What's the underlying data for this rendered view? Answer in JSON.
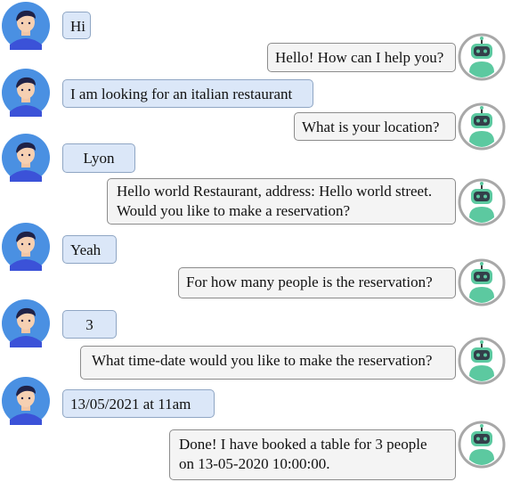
{
  "conversation": {
    "messages": [
      {
        "speaker": "user",
        "text": "Hi"
      },
      {
        "speaker": "bot",
        "text": "Hello! How can I help you?"
      },
      {
        "speaker": "user",
        "text": "I am looking for an italian restaurant"
      },
      {
        "speaker": "bot",
        "text": "What is your location?"
      },
      {
        "speaker": "user",
        "text": "Lyon"
      },
      {
        "speaker": "bot",
        "lines": [
          "Hello world Restaurant, address: Hello world street.",
          "Would you like to make a reservation?"
        ]
      },
      {
        "speaker": "user",
        "text": "Yeah"
      },
      {
        "speaker": "bot",
        "text": "For how many people is the reservation?"
      },
      {
        "speaker": "user",
        "text": "3"
      },
      {
        "speaker": "bot",
        "text": "What time-date would you like to make the reservation?"
      },
      {
        "speaker": "user",
        "text": "13/05/2021 at 11am"
      },
      {
        "speaker": "bot",
        "lines": [
          "Done! I have booked a table for 3 people",
          "on 13-05-2020 10:00:00."
        ]
      }
    ]
  },
  "icons": {
    "user_avatar": "user-avatar-icon",
    "bot_avatar": "robot-avatar-icon"
  },
  "colors": {
    "user_bubble": "#dbe7f8",
    "bot_bubble": "#f4f4f4",
    "user_avatar_bg": "#4a90e2",
    "bot_avatar_accent": "#5cc9a0"
  }
}
